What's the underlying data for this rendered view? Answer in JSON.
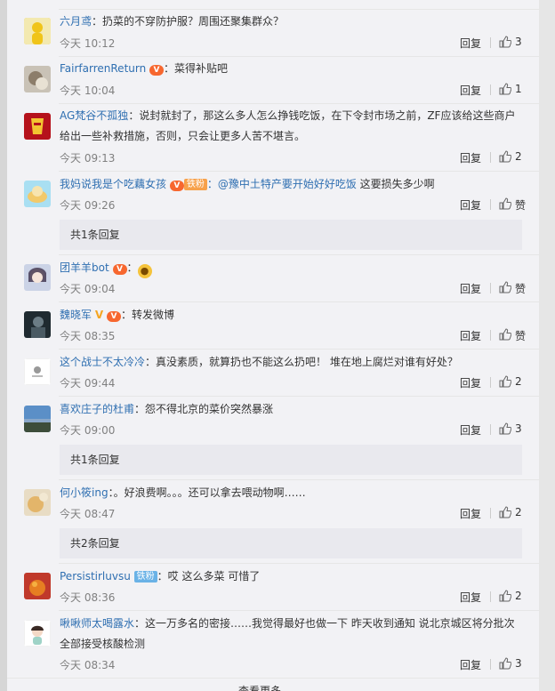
{
  "reply_label": "回复",
  "comments": [
    {
      "user": "六月鸢",
      "text": "：扔菜的不穿防护服？周围还聚集群众？",
      "time": "今天 10:12",
      "likes": "3"
    },
    {
      "user": "FairfarrenReturn",
      "text": "：菜得补贴吧",
      "time": "今天 10:04",
      "likes": "1"
    },
    {
      "user": "AG梵谷不孤独",
      "text": "：说封就封了，那这么多人怎么挣钱吃饭，在下令封市场之前，ZF应该给这些商户给出一些补救措施，否则，只会让更多人苦不堪言。",
      "time": "今天 09:13",
      "likes": "2"
    },
    {
      "user": "我妈说我是个吃藕女孩",
      "badge": "铁粉",
      "mention": "：@豫中土特产要开始好好吃饭",
      "text": " 这要损失多少啊",
      "time": "今天 09:26",
      "likes": "赞",
      "subreplies": "共1条回复"
    },
    {
      "user": "团羊羊bot",
      "text": "：",
      "emoji": "doge",
      "time": "今天 09:04",
      "likes": "赞"
    },
    {
      "user": "魏晓军",
      "text": "：转发微博",
      "time": "今天 08:35",
      "likes": "赞"
    },
    {
      "user": "这个战士不太冷冷",
      "text": "：真没素质，就算扔也不能这么扔吧！ 堆在地上腐烂对谁有好处？",
      "time": "今天 09:44",
      "likes": "2"
    },
    {
      "user": "喜欢庄子的杜甫",
      "text": "：怨不得北京的菜价突然暴涨",
      "time": "今天 09:00",
      "likes": "3",
      "subreplies": "共1条回复"
    },
    {
      "user": "何小筱ing",
      "text": "：。好浪费啊。。。还可以拿去喂动物啊……",
      "time": "今天 08:47",
      "likes": "2",
      "subreplies": "共2条回复"
    },
    {
      "user": "Persistirluvsu",
      "badge": "铁粉",
      "text": "：哎 这么多菜 可惜了",
      "time": "今天 08:36",
      "likes": "2"
    },
    {
      "user": "啾啾师太喝露水",
      "text": "：这一万多名的密接……我觉得最好也做一下 昨天收到通知 说北京城区将分批次全部接受核酸检测",
      "time": "今天 08:34",
      "likes": "3"
    }
  ],
  "more_label": "查看更多"
}
